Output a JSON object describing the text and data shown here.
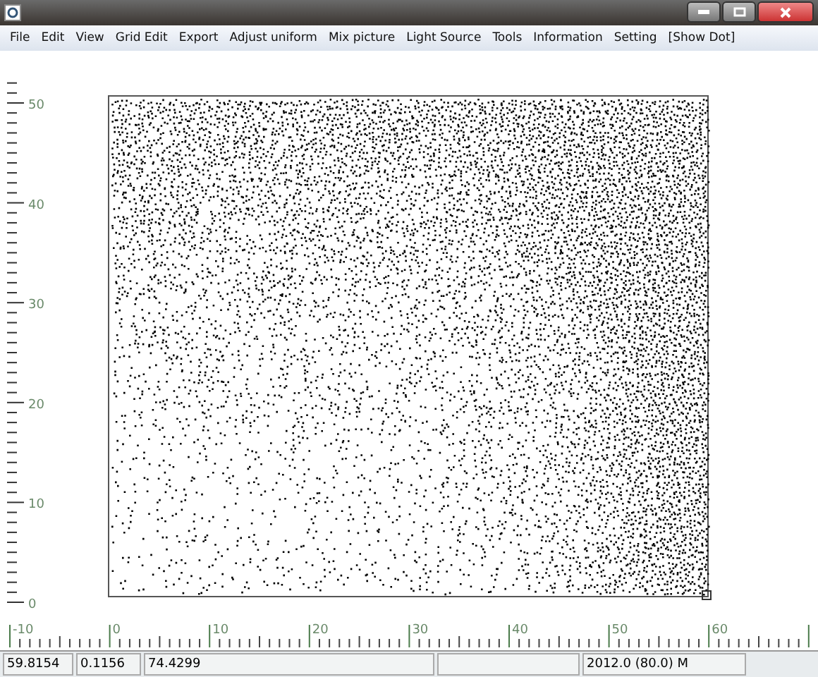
{
  "menu": [
    "File",
    "Edit",
    "View",
    "Grid Edit",
    "Export",
    "Adjust uniform",
    "Mix picture",
    "Light Source",
    "Tools",
    "Information",
    "Setting",
    "[Show Dot]"
  ],
  "left_ruler": {
    "labels": [
      "50",
      "40",
      "30",
      "20",
      "10",
      "0"
    ]
  },
  "bottom_ruler": {
    "labels": [
      "-10",
      "0",
      "10",
      "20",
      "30",
      "40",
      "50",
      "60"
    ]
  },
  "status_bar": [
    "59.8154",
    "0.1156",
    "74.4299",
    "2012.0 (80.0) M"
  ]
}
